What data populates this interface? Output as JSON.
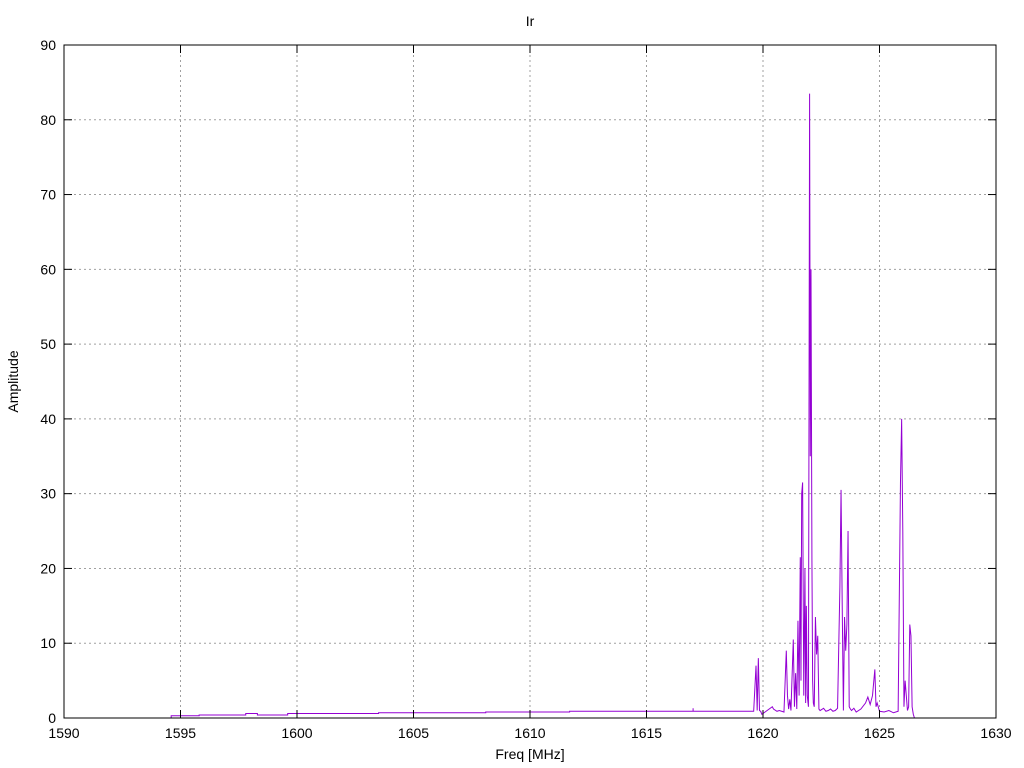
{
  "chart_data": {
    "type": "line",
    "title": "Ir",
    "xlabel": "Freq [MHz]",
    "ylabel": "Amplitude",
    "xlim": [
      1590,
      1630
    ],
    "ylim": [
      0,
      90
    ],
    "xticks": [
      1590,
      1595,
      1600,
      1605,
      1610,
      1615,
      1620,
      1625,
      1630
    ],
    "yticks": [
      0,
      10,
      20,
      30,
      40,
      50,
      60,
      70,
      80,
      90
    ],
    "grid": true,
    "line_color": "#9400d3",
    "series": [
      {
        "values_x": [
          1594.6,
          1594.6,
          1595.8,
          1595.8,
          1597.8,
          1597.8,
          1598.3,
          1598.3,
          1599.6,
          1599.6,
          1603.5,
          1603.5,
          1608.1,
          1608.1,
          1611.7,
          1611.7,
          1617.0,
          1617.0,
          1617.0,
          1619.6,
          1619.7,
          1619.75,
          1619.8,
          1619.85,
          1619.9,
          1619.95,
          1620.0,
          1620.4,
          1620.45,
          1620.6,
          1620.7,
          1620.9,
          1621.0,
          1621.05,
          1621.1,
          1621.15,
          1621.2,
          1621.3,
          1621.35,
          1621.4,
          1621.45,
          1621.5,
          1621.55,
          1621.6,
          1621.63,
          1621.66,
          1621.7,
          1621.75,
          1621.8,
          1621.83,
          1621.86,
          1621.9,
          1621.95,
          1622.0,
          1622.03,
          1622.06,
          1622.1,
          1622.13,
          1622.16,
          1622.2,
          1622.25,
          1622.3,
          1622.35,
          1622.4,
          1622.45,
          1622.5,
          1622.6,
          1622.7,
          1622.8,
          1622.9,
          1623.0,
          1623.1,
          1623.2,
          1623.3,
          1623.35,
          1623.4,
          1623.45,
          1623.5,
          1623.55,
          1623.6,
          1623.65,
          1623.7,
          1623.75,
          1623.8,
          1623.9,
          1624.0,
          1624.2,
          1624.4,
          1624.5,
          1624.6,
          1624.7,
          1624.8,
          1624.85,
          1624.9,
          1625.0,
          1625.2,
          1625.4,
          1625.6,
          1625.8,
          1625.9,
          1625.95,
          1626.0,
          1626.05,
          1626.1,
          1626.15,
          1626.2,
          1626.25,
          1626.3,
          1626.35,
          1626.4,
          1626.45,
          1626.5
        ],
        "values_y": [
          0.0,
          0.3,
          0.3,
          0.4,
          0.4,
          0.6,
          0.6,
          0.4,
          0.4,
          0.6,
          0.6,
          0.7,
          0.7,
          0.8,
          0.8,
          0.9,
          0.9,
          1.3,
          0.9,
          0.9,
          7.0,
          1.0,
          8.0,
          1.0,
          0.9,
          0.5,
          0.6,
          1.5,
          1.2,
          0.9,
          1.0,
          0.8,
          9.0,
          3.0,
          1.2,
          2.5,
          1.0,
          10.5,
          1.5,
          6.0,
          1.2,
          13.0,
          3.0,
          21.5,
          5.0,
          30.0,
          31.5,
          3.0,
          20.0,
          2.0,
          15.0,
          3.0,
          1.5,
          83.5,
          35.0,
          60.0,
          21.0,
          5.0,
          2.0,
          1.5,
          13.5,
          8.5,
          11.0,
          1.2,
          1.0,
          1.1,
          1.3,
          0.9,
          1.0,
          1.2,
          0.9,
          1.0,
          1.3,
          17.5,
          30.5,
          15.0,
          1.0,
          13.5,
          9.0,
          12.5,
          25.0,
          1.5,
          1.2,
          1.0,
          1.3,
          0.8,
          1.2,
          2.0,
          2.8,
          1.8,
          3.0,
          6.5,
          1.5,
          2.0,
          0.9,
          0.8,
          1.0,
          0.7,
          0.9,
          31.5,
          40.0,
          25.0,
          1.5,
          5.0,
          3.0,
          1.0,
          1.5,
          12.5,
          11.0,
          1.5,
          0.5,
          0.0
        ]
      }
    ]
  }
}
